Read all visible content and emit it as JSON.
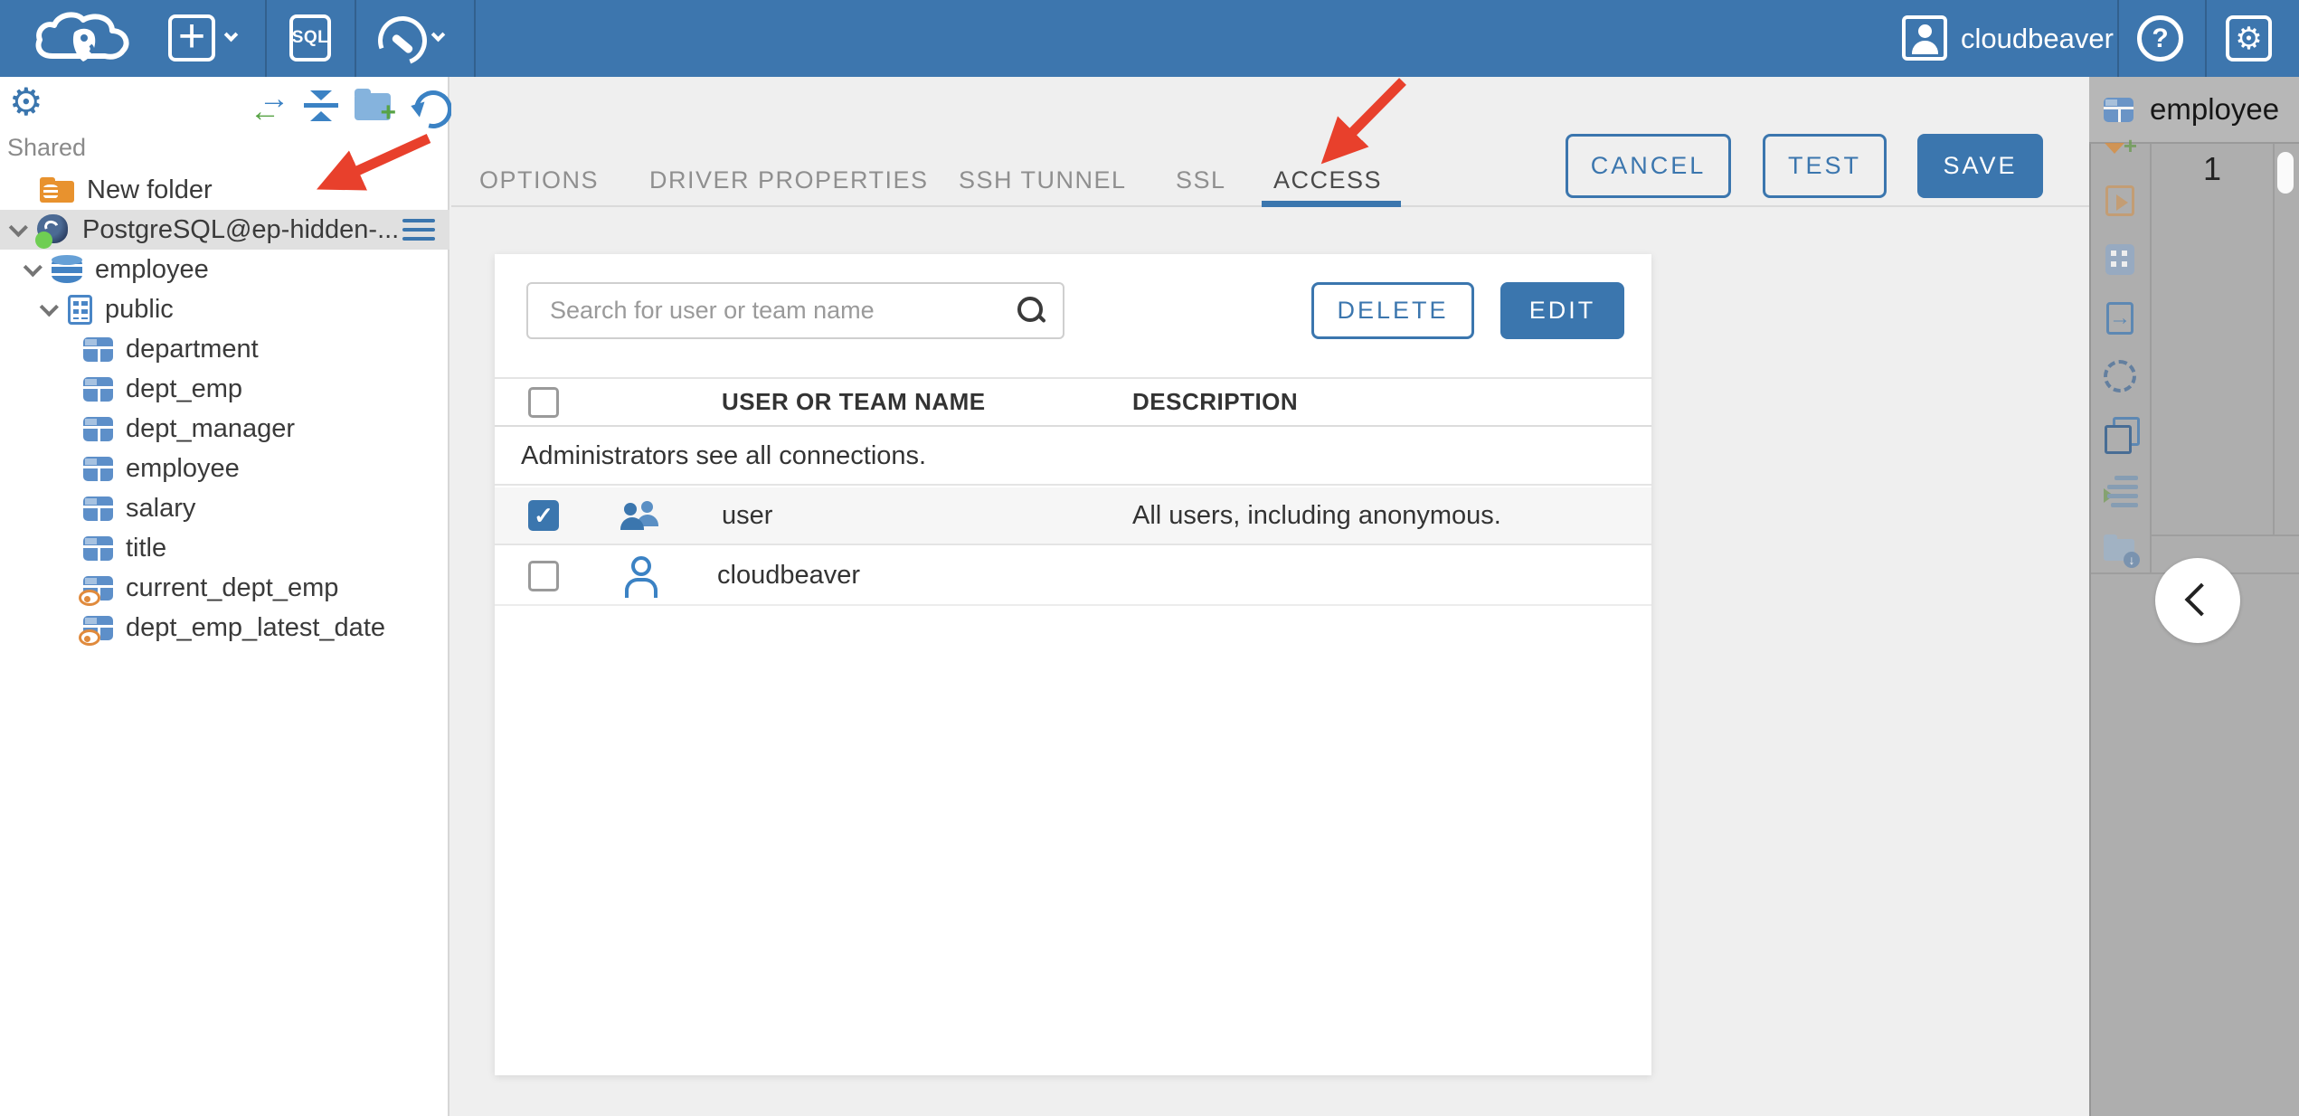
{
  "colors": {
    "header_bg": "#3d76ae",
    "accent_blue": "#3b76ae",
    "annotation_arrow_red": "#e8402c",
    "selected_tree_row_bg": "#e0e0e0",
    "selected_table_row_bg": "#f6f6f6"
  },
  "header": {
    "sql_button_label": "SQL",
    "user_name": "cloudbeaver",
    "icons": [
      "cloudbeaver-logo",
      "new-connection-plus",
      "sql-editor",
      "connection-wrench",
      "user-avatar",
      "help",
      "settings-gear"
    ]
  },
  "sidebar": {
    "section_label": "Shared",
    "toolbar_icons": [
      "settings-gear",
      "sync-connections",
      "collapse-all",
      "add-folder",
      "refresh"
    ],
    "tree": [
      {
        "label": "New folder",
        "icon": "folder"
      },
      {
        "label": "PostgreSQL@ep-hidden-...",
        "icon": "postgresql",
        "selected": true,
        "expanded": true
      },
      {
        "label": "employee",
        "icon": "database",
        "expanded": true
      },
      {
        "label": "public",
        "icon": "schema",
        "expanded": true
      },
      {
        "label": "department",
        "icon": "table"
      },
      {
        "label": "dept_emp",
        "icon": "table"
      },
      {
        "label": "dept_manager",
        "icon": "table"
      },
      {
        "label": "employee",
        "icon": "table"
      },
      {
        "label": "salary",
        "icon": "table"
      },
      {
        "label": "title",
        "icon": "table"
      },
      {
        "label": "current_dept_emp",
        "icon": "view"
      },
      {
        "label": "dept_emp_latest_date",
        "icon": "view"
      }
    ]
  },
  "main": {
    "tabs": [
      {
        "label": "OPTIONS",
        "active": false
      },
      {
        "label": "DRIVER PROPERTIES",
        "active": false
      },
      {
        "label": "SSH TUNNEL",
        "active": false
      },
      {
        "label": "SSL",
        "active": false
      },
      {
        "label": "ACCESS",
        "active": true
      }
    ],
    "actions": {
      "cancel": "CANCEL",
      "test": "TEST",
      "save": "SAVE"
    },
    "access": {
      "search_placeholder": "Search for user or team name",
      "delete_label": "DELETE",
      "edit_label": "EDIT",
      "columns": {
        "name": "USER OR TEAM NAME",
        "description": "DESCRIPTION"
      },
      "info_row": "Administrators see all connections.",
      "rows": [
        {
          "name": "user",
          "description": "All users, including anonymous.",
          "checked": true,
          "type": "team"
        },
        {
          "name": "cloudbeaver",
          "description": "",
          "checked": false,
          "type": "user"
        }
      ]
    }
  },
  "right_panel": {
    "tab_label": "employee",
    "row_number": "1",
    "toolbar_icons": [
      "add-filter",
      "run-script",
      "form-view",
      "export-data",
      "ai-assistant",
      "duplicate",
      "execution-log",
      "save-to-folder"
    ],
    "collapse_chevron": "left"
  }
}
